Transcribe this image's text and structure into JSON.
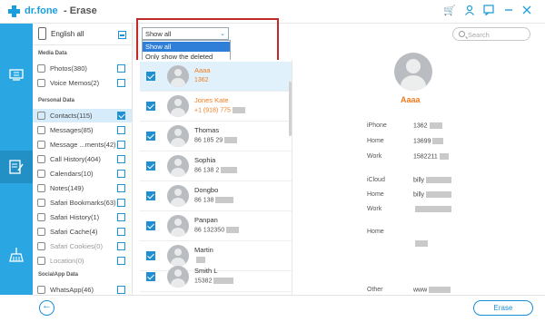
{
  "app": {
    "brand": "dr.fone",
    "title": "- Erase"
  },
  "titlebar_icons": [
    "cart-icon",
    "user-icon",
    "feedback-icon",
    "minimize-icon",
    "close-icon"
  ],
  "device": {
    "label": "English all"
  },
  "sections": {
    "media": "Media Data",
    "personal": "Personal Data",
    "social": "SocialApp Data"
  },
  "categories": [
    {
      "label": "Photos(380)",
      "icon": "photo-icon",
      "checked": false
    },
    {
      "label": "Voice Memos(2)",
      "icon": "voice-memo-icon",
      "checked": false
    },
    {
      "label": "Contacts(115)",
      "icon": "contacts-icon",
      "checked": true
    },
    {
      "label": "Messages(85)",
      "icon": "messages-icon",
      "checked": false
    },
    {
      "label": "Message ...ments(42)",
      "icon": "attachment-icon",
      "checked": false
    },
    {
      "label": "Call History(404)",
      "icon": "phone-icon",
      "checked": false
    },
    {
      "label": "Calendars(10)",
      "icon": "calendar-icon",
      "checked": false
    },
    {
      "label": "Notes(149)",
      "icon": "notes-icon",
      "checked": false
    },
    {
      "label": "Safari Bookmarks(63)",
      "icon": "bookmark-icon",
      "checked": false
    },
    {
      "label": "Safari History(1)",
      "icon": "history-icon",
      "checked": false
    },
    {
      "label": "Safari Cache(4)",
      "icon": "cache-icon",
      "checked": false
    },
    {
      "label": "Safari Cookies(0)",
      "icon": "cookie-icon",
      "checked": false
    },
    {
      "label": "Location(0)",
      "icon": "location-icon",
      "checked": false
    },
    {
      "label": "WhatsApp(46)",
      "icon": "whatsapp-icon",
      "checked": false
    }
  ],
  "filter": {
    "selected": "Show all",
    "options": [
      "Show all",
      "Only show the deleted"
    ]
  },
  "search": {
    "placeholder": "Search"
  },
  "contacts": [
    {
      "name": "Aaaa",
      "phone": "1362",
      "orange": true
    },
    {
      "name": "Jones Kate",
      "phone": "+1 (918) 775",
      "orange": true
    },
    {
      "name": "Thomas",
      "phone": "86 185 29",
      "orange": false
    },
    {
      "name": "Sophia",
      "phone": "86 138 2",
      "orange": false
    },
    {
      "name": "Dongbo",
      "phone": "86 138",
      "orange": false
    },
    {
      "name": "Panpan",
      "phone": "86 132350",
      "orange": false
    },
    {
      "name": "Martin",
      "phone": "",
      "orange": false
    },
    {
      "name": "Smith L",
      "phone": "15382",
      "orange": false
    }
  ],
  "detail": {
    "name": "Aaaa",
    "fields": [
      {
        "label": "iPhone",
        "value": "1362"
      },
      {
        "label": "Home",
        "value": "13699"
      },
      {
        "label": "Work",
        "value": "1582211"
      },
      {
        "label": "iCloud",
        "value": "billy"
      },
      {
        "label": "Home",
        "value": "billy"
      },
      {
        "label": "Work",
        "value": ""
      },
      {
        "label": "Home",
        "value": ""
      },
      {
        "label": "Other",
        "value": "www"
      }
    ]
  },
  "footer": {
    "erase_label": "Erase"
  },
  "colors": {
    "accent": "#2aa7e2",
    "highlight": "#ef7d22",
    "annotation": "#c22a2a"
  }
}
